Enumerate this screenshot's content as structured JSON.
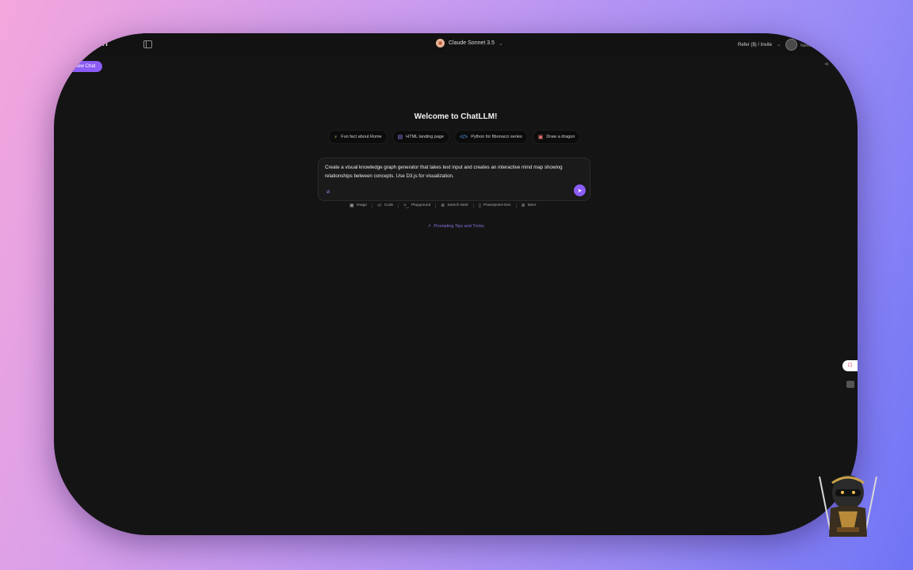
{
  "app": {
    "brand": "S.AI",
    "model": "Claude Sonnet 3.5",
    "refer": "Refer ($) / Invite",
    "user_name": "Name"
  },
  "sidebar": {
    "new_chat": "New Chat"
  },
  "main": {
    "welcome": "Welcome to ChatLLM!",
    "suggestions": [
      {
        "icon": "lightbulb-icon",
        "label": "Fun fact about Rome"
      },
      {
        "icon": "layout-icon",
        "label": "HTML landing page"
      },
      {
        "icon": "code-icon",
        "label": "Python for fibonacci series"
      },
      {
        "icon": "image-icon",
        "label": "Draw a dragon"
      }
    ],
    "prompt": "Create a visual knowledge graph generator that takes text input and creates an interactive mind map showing relationships between concepts. Use D3.js for visualization.",
    "tools": [
      {
        "icon": "image-icon",
        "label": "Image"
      },
      {
        "icon": "code-icon",
        "label": "Code"
      },
      {
        "icon": "terminal-icon",
        "label": "Playground"
      },
      {
        "icon": "globe-icon",
        "label": "Search Web"
      },
      {
        "icon": "document-icon",
        "label": "Powerpoint-Gen"
      },
      {
        "icon": "plus-circle-icon",
        "label": "More"
      }
    ],
    "tips": "Prompting Tips and Tricks"
  },
  "colors": {
    "accent": "#8b5cf6",
    "background": "#141414"
  }
}
